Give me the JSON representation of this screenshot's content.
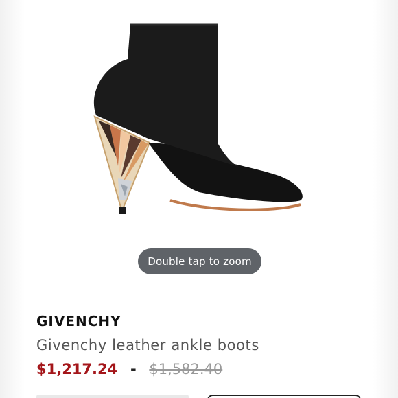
{
  "product_image": {
    "description_icon": "ankle-boot-image"
  },
  "zoom_hint": "Double tap to zoom",
  "product": {
    "brand": "GIVENCHY",
    "title": "Givenchy leather ankle boots",
    "price": "$1,217.24",
    "separator": "-",
    "original_price": "$1,582.40"
  },
  "colors": {
    "sale_price": "#a4161a",
    "zoom_pill": "#5f6368"
  }
}
